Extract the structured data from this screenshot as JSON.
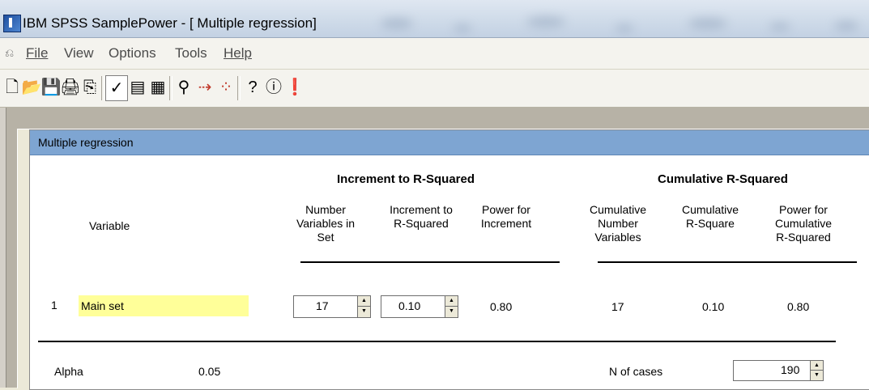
{
  "window": {
    "title": "IBM SPSS SamplePower - [ Multiple regression]"
  },
  "menu": {
    "items": [
      "File",
      "View",
      "Options",
      "Tools",
      "Help"
    ]
  },
  "toolbar": {
    "icons": [
      "new-file-icon",
      "open-folder-icon",
      "save-icon",
      "print-icon",
      "copy-icon",
      "check-icon",
      "report-icon",
      "table-icon",
      "find-icon",
      "binoculars-arrow-icon",
      "scatter-arrow-icon",
      "help-icon",
      "tip-icon",
      "alert-icon"
    ]
  },
  "panel": {
    "header": "Multiple regression",
    "group_increment": "Increment to R-Squared",
    "group_cumulative": "Cumulative R-Squared",
    "columns": {
      "variable": "Variable",
      "num_vars": [
        "Number",
        "Variables in",
        "Set"
      ],
      "increment": [
        "Increment to",
        "R-Squared"
      ],
      "power_inc": [
        "Power for",
        "Increment"
      ],
      "cum_num": [
        "Cumulative",
        "Number",
        "Variables"
      ],
      "cum_r2": [
        "Cumulative",
        "R-Square"
      ],
      "power_cum": [
        "Power for",
        "Cumulative",
        "R-Squared"
      ]
    },
    "row": {
      "index": "1",
      "variable": "Main set",
      "num_vars": "17",
      "increment": "0.10",
      "power_inc": "0.80",
      "cum_num": "17",
      "cum_r2": "0.10",
      "power_cum": "0.80"
    },
    "footer": {
      "alpha_label": "Alpha",
      "alpha_value": "0.05",
      "n_label": "N of cases",
      "n_value": "190"
    }
  }
}
